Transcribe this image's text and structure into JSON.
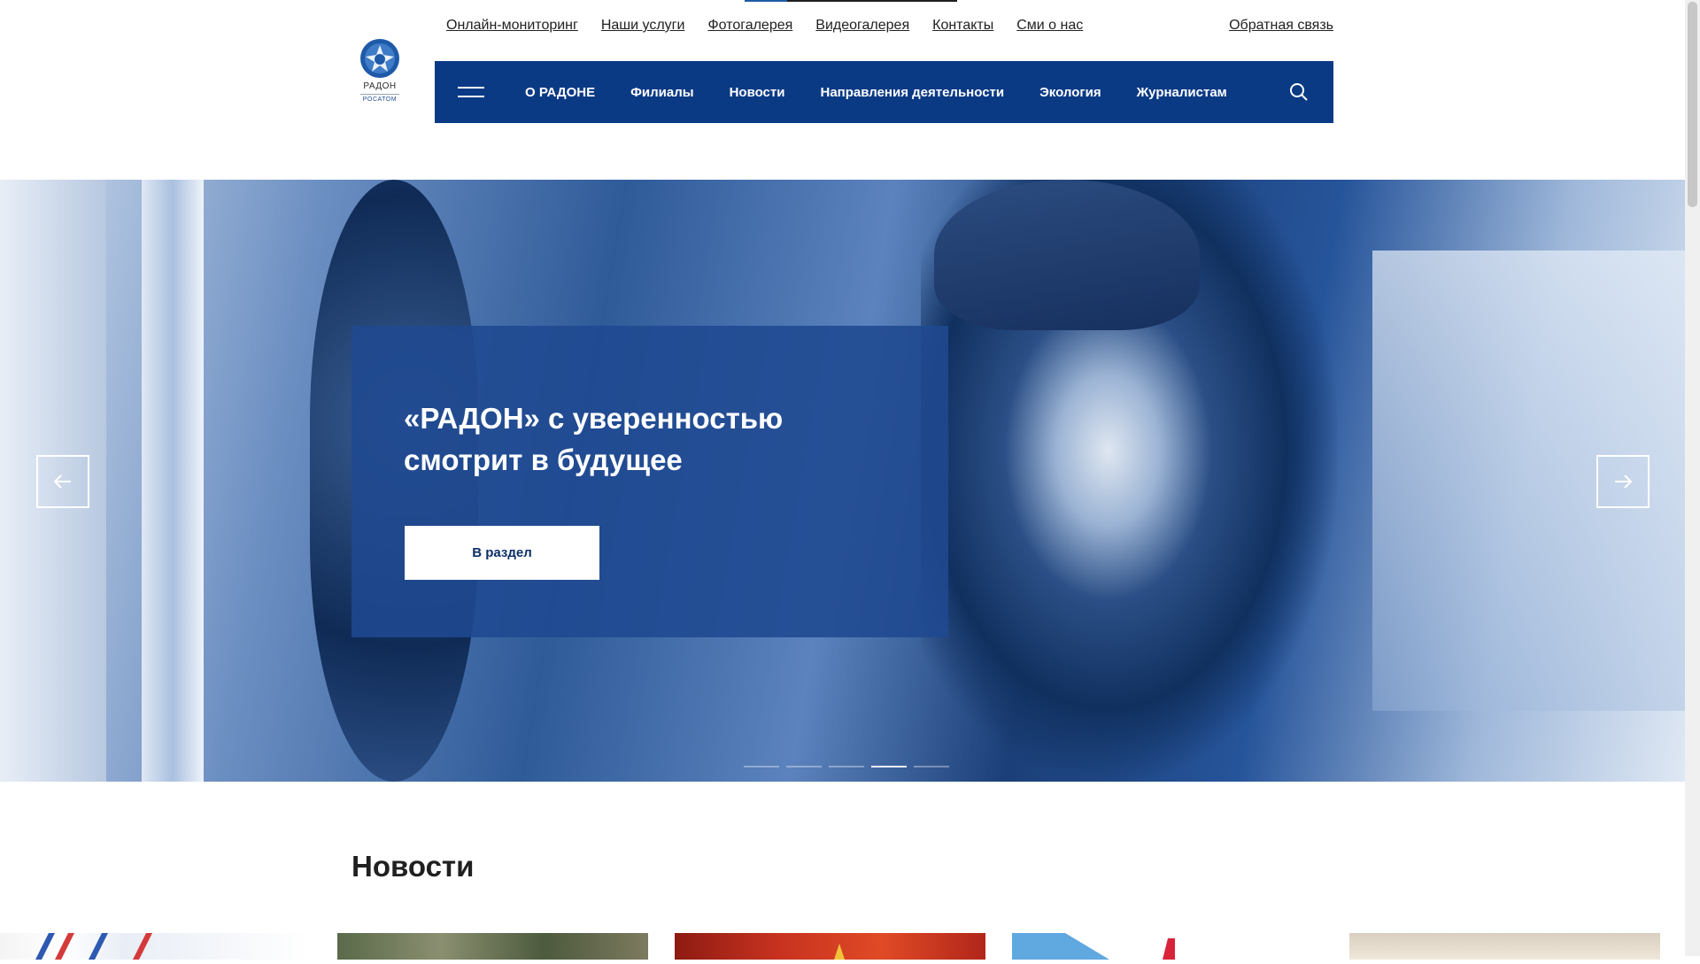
{
  "header": {
    "logo": {
      "name": "РАДОН",
      "subname": "РОСАТОМ"
    },
    "utility_links": [
      "Онлайн-мониторинг",
      "Наши услуги",
      "Фотогалерея",
      "Видеогалерея",
      "Контакты",
      "Сми о нас"
    ],
    "feedback_link": "Обратная связь",
    "nav": [
      "О РАДОНЕ",
      "Филиалы",
      "Новости",
      "Направления деятельности",
      "Экология",
      "Журналистам"
    ],
    "icons": {
      "menu": "burger-menu-icon",
      "search": "search-icon"
    },
    "nav_color": "#0b3a85"
  },
  "hero": {
    "slide_title": "«РАДОН» с уверенностью смотрит в будущее",
    "button_label": "В раздел",
    "icons": {
      "prev": "arrow-left-icon",
      "next": "arrow-right-icon"
    },
    "slide_count": 5,
    "active_slide": 3,
    "overlay_color": "#1f4991"
  },
  "news": {
    "heading": "Новости",
    "card_count": 5
  },
  "colors": {
    "brand": "#0b3a85",
    "text": "#1f1f1f"
  }
}
